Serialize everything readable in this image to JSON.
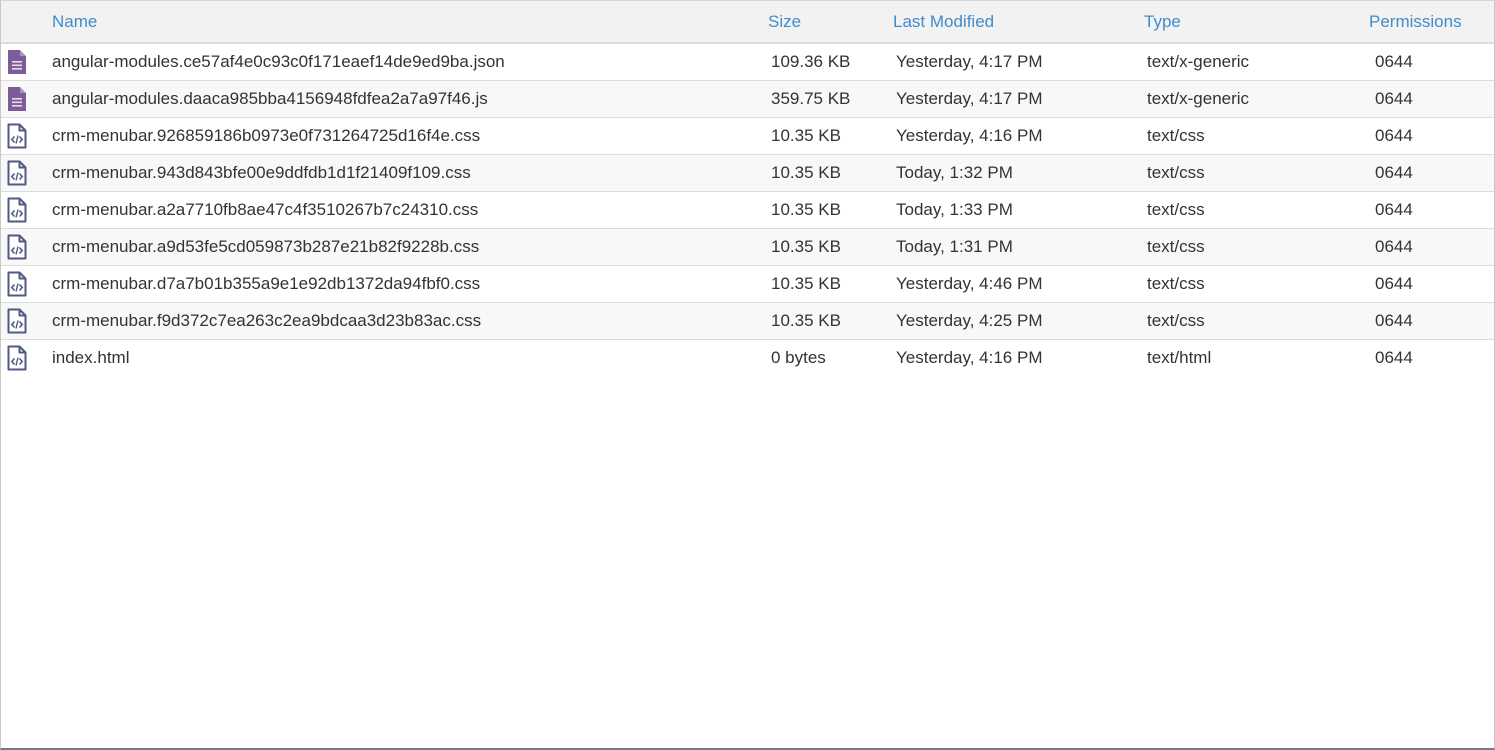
{
  "table": {
    "columns": [
      {
        "key": "name",
        "label": "Name"
      },
      {
        "key": "size",
        "label": "Size"
      },
      {
        "key": "modified",
        "label": "Last Modified"
      },
      {
        "key": "type",
        "label": "Type"
      },
      {
        "key": "permissions",
        "label": "Permissions"
      }
    ],
    "rows": [
      {
        "icon": "document-icon",
        "name": "angular-modules.ce57af4e0c93c0f171eaef14de9ed9ba.json",
        "size": "109.36 KB",
        "modified": "Yesterday, 4:17 PM",
        "type": "text/x-generic",
        "permissions": "0644"
      },
      {
        "icon": "document-icon",
        "name": "angular-modules.daaca985bba4156948fdfea2a7a97f46.js",
        "size": "359.75 KB",
        "modified": "Yesterday, 4:17 PM",
        "type": "text/x-generic",
        "permissions": "0644"
      },
      {
        "icon": "code-file-icon",
        "name": "crm-menubar.926859186b0973e0f731264725d16f4e.css",
        "size": "10.35 KB",
        "modified": "Yesterday, 4:16 PM",
        "type": "text/css",
        "permissions": "0644"
      },
      {
        "icon": "code-file-icon",
        "name": "crm-menubar.943d843bfe00e9ddfdb1d1f21409f109.css",
        "size": "10.35 KB",
        "modified": "Today, 1:32 PM",
        "type": "text/css",
        "permissions": "0644"
      },
      {
        "icon": "code-file-icon",
        "name": "crm-menubar.a2a7710fb8ae47c4f3510267b7c24310.css",
        "size": "10.35 KB",
        "modified": "Today, 1:33 PM",
        "type": "text/css",
        "permissions": "0644"
      },
      {
        "icon": "code-file-icon",
        "name": "crm-menubar.a9d53fe5cd059873b287e21b82f9228b.css",
        "size": "10.35 KB",
        "modified": "Today, 1:31 PM",
        "type": "text/css",
        "permissions": "0644"
      },
      {
        "icon": "code-file-icon",
        "name": "crm-menubar.d7a7b01b355a9e1e92db1372da94fbf0.css",
        "size": "10.35 KB",
        "modified": "Yesterday, 4:46 PM",
        "type": "text/css",
        "permissions": "0644"
      },
      {
        "icon": "code-file-icon",
        "name": "crm-menubar.f9d372c7ea263c2ea9bdcaa3d23b83ac.css",
        "size": "10.35 KB",
        "modified": "Yesterday, 4:25 PM",
        "type": "text/css",
        "permissions": "0644"
      },
      {
        "icon": "code-file-icon",
        "name": "index.html",
        "size": "0 bytes",
        "modified": "Yesterday, 4:16 PM",
        "type": "text/html",
        "permissions": "0644"
      }
    ]
  },
  "colors": {
    "header_link": "#428bca",
    "document_icon": "#7e5b99",
    "code_icon": "#4f5b80",
    "stripe": "#f8f8f8",
    "header_bg": "#f2f2f2"
  }
}
